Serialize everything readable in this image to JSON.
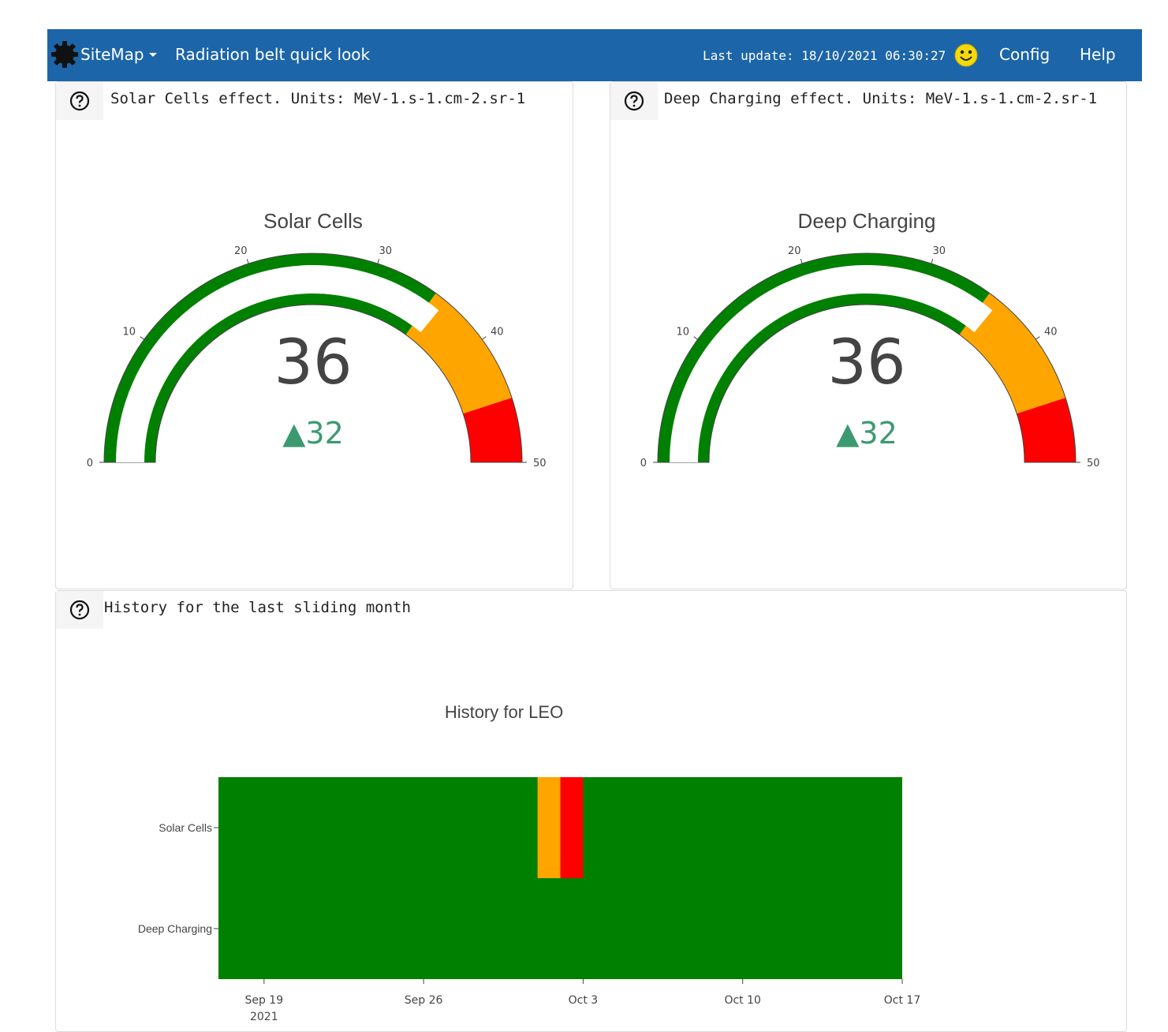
{
  "navbar": {
    "sitemap_label": "SiteMap",
    "title": "Radiation belt quick look",
    "last_update": "Last update: 18/10/2021 06:30:27",
    "config_label": "Config",
    "help_label": "Help",
    "status_icon": "smiley-icon",
    "colors": {
      "background": "#1c65a8",
      "smiley": "#f5d90a"
    }
  },
  "panels": {
    "solar": {
      "header": "Solar Cells effect. Units: MeV-1.s-1.cm-2.sr-1"
    },
    "deep": {
      "header": "Deep Charging effect. Units: MeV-1.s-1.cm-2.sr-1"
    },
    "history": {
      "header": "History for the last sliding month"
    }
  },
  "chart_data": [
    {
      "type": "gauge",
      "title": "Solar Cells",
      "value": 36,
      "delta": "▲32",
      "reference": 32,
      "range": [
        0,
        50
      ],
      "ticks": [
        "0",
        "10",
        "20",
        "30",
        "40",
        "50"
      ],
      "steps": [
        {
          "range": [
            0,
            35
          ],
          "color": "#008000"
        },
        {
          "range": [
            35,
            45
          ],
          "color": "#ffa500"
        },
        {
          "range": [
            45,
            50
          ],
          "color": "#ff0000"
        }
      ],
      "bar_color": "#008000"
    },
    {
      "type": "gauge",
      "title": "Deep Charging",
      "value": 36,
      "delta": "▲32",
      "reference": 32,
      "range": [
        0,
        50
      ],
      "ticks": [
        "0",
        "10",
        "20",
        "30",
        "40",
        "50"
      ],
      "steps": [
        {
          "range": [
            0,
            35
          ],
          "color": "#008000"
        },
        {
          "range": [
            35,
            45
          ],
          "color": "#ffa500"
        },
        {
          "range": [
            45,
            50
          ],
          "color": "#ff0000"
        }
      ],
      "bar_color": "#008000"
    },
    {
      "type": "heatmap",
      "title": "History for LEO",
      "y_categories": [
        "Solar Cells",
        "Deep Charging"
      ],
      "x_ticks": [
        {
          "label": "Sep 19",
          "sublabel": "2021",
          "date": "2021-09-19"
        },
        {
          "label": "Sep 26",
          "date": "2021-09-26"
        },
        {
          "label": "Oct 3",
          "date": "2021-10-03"
        },
        {
          "label": "Oct 10",
          "date": "2021-10-10"
        },
        {
          "label": "Oct 17",
          "date": "2021-10-17"
        }
      ],
      "x_range": [
        "2021-09-17",
        "2021-10-17"
      ],
      "default_color": "#008000",
      "segments": [
        {
          "series": "Solar Cells",
          "from": "2021-10-01",
          "to": "2021-10-02",
          "level": "warning",
          "color": "#ffa500"
        },
        {
          "series": "Solar Cells",
          "from": "2021-10-02",
          "to": "2021-10-03",
          "level": "alert",
          "color": "#ff0000"
        }
      ]
    }
  ]
}
